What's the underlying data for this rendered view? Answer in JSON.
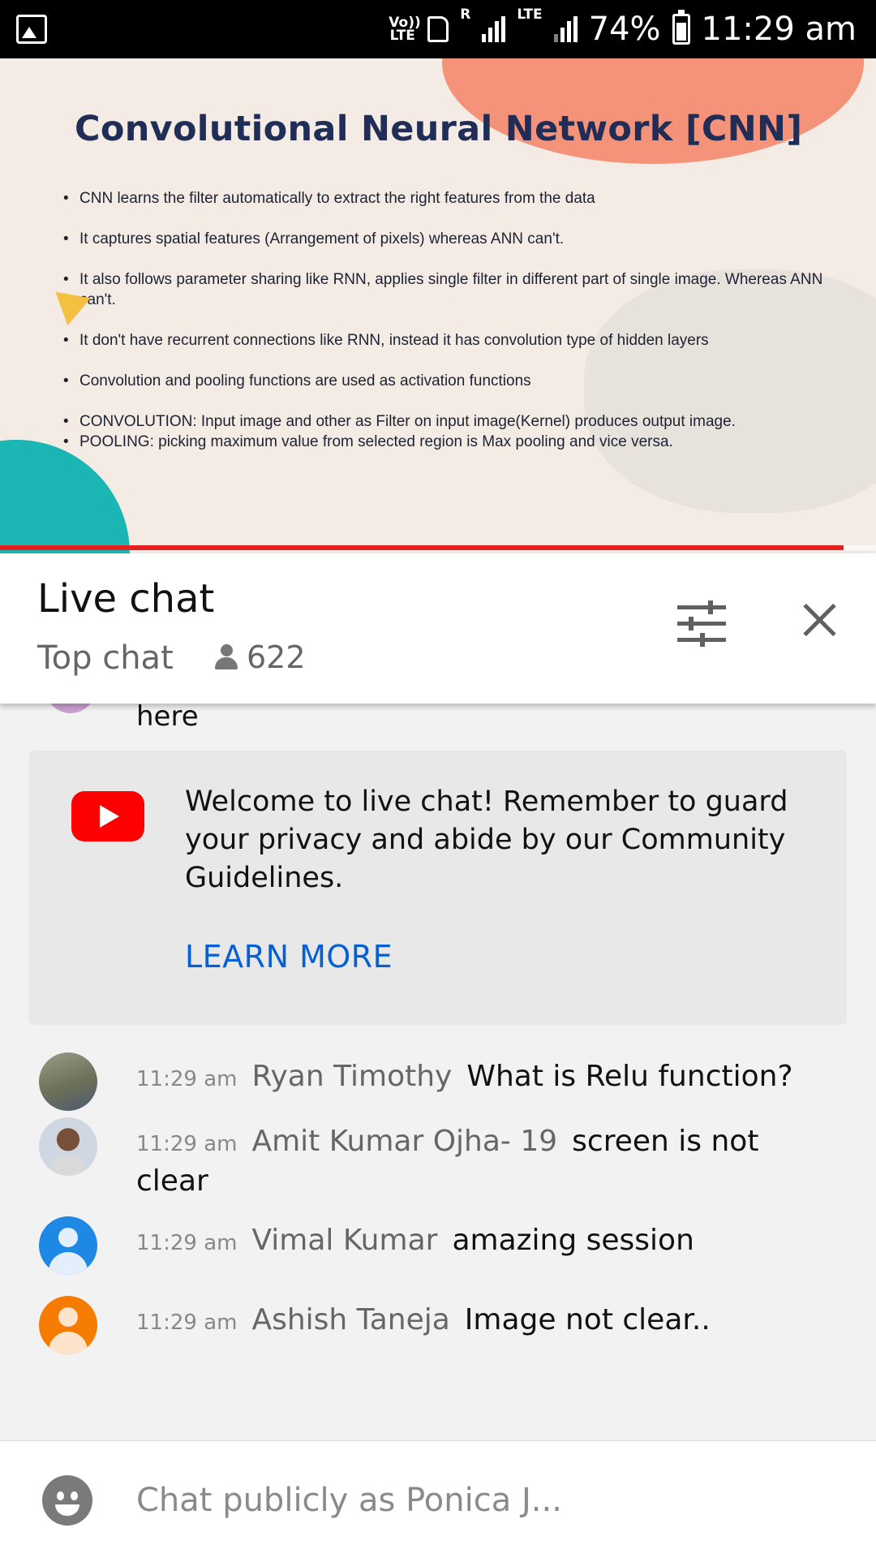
{
  "status_bar": {
    "volte": "Vo)) LTE",
    "roaming": "R",
    "lte": "LTE",
    "battery": "74%",
    "time": "11:29 am"
  },
  "video": {
    "title": "Convolutional Neural Network [CNN]",
    "bullets": [
      "CNN learns the filter automatically to extract the right features from the data",
      "It captures spatial features (Arrangement of pixels) whereas ANN can't.",
      "It also follows parameter sharing like RNN, applies single filter in different part of single image. Whereas ANN can't.",
      "It don't have recurrent connections like RNN, instead it has convolution type of hidden layers",
      "Convolution and pooling functions are used as activation functions",
      "CONVOLUTION: Input image and other as Filter on input image(Kernel) produces output image.",
      "POOLING: picking maximum value from selected region is Max pooling and vice versa."
    ],
    "progress_fraction": 0.963,
    "colors": {
      "progress": "#e52020",
      "title": "#1f2d57"
    }
  },
  "chat_header": {
    "title": "Live chat",
    "mode": "Top chat",
    "viewer_count": "622"
  },
  "partial_message": {
    "text": "here"
  },
  "welcome": {
    "text": "Welcome to live chat! Remember to guard your privacy and abide by our Community Guidelines.",
    "link": "LEARN MORE"
  },
  "messages": [
    {
      "time": "11:29 am",
      "author": "Ryan Timothy",
      "text": "What is Relu function?",
      "avatar": "photo"
    },
    {
      "time": "11:29 am",
      "author": "Amit Kumar Ojha- 19",
      "text": "screen is not",
      "continuation": "clear",
      "avatar": "photo"
    },
    {
      "time": "11:29 am",
      "author": "Vimal Kumar",
      "text": "amazing session",
      "avatar": "default-blue"
    },
    {
      "time": "11:29 am",
      "author": "Ashish Taneja",
      "text": "Image not clear..",
      "avatar": "default-orange"
    }
  ],
  "input": {
    "placeholder": "Chat publicly as Ponica J..."
  }
}
